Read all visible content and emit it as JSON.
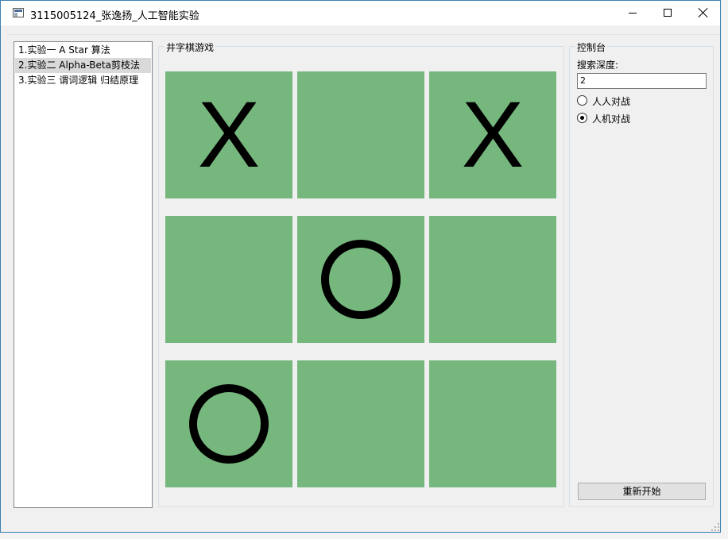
{
  "window": {
    "title": "3115005124_张逸扬_人工智能实验"
  },
  "experiments": [
    {
      "label": "1.实验一  A Star 算法",
      "selected": false
    },
    {
      "label": "2.实验二  Alpha-Beta剪枝法",
      "selected": true
    },
    {
      "label": "3.实验三  谓词逻辑 归结原理",
      "selected": false
    }
  ],
  "game": {
    "title": "井字棋游戏",
    "board": [
      "X",
      "",
      "X",
      "",
      "O",
      "",
      "O",
      "",
      ""
    ]
  },
  "console": {
    "title": "控制台",
    "depth_label": "搜索深度:",
    "depth_value": "2",
    "modes": [
      {
        "label": "人人对战",
        "checked": false
      },
      {
        "label": "人机对战",
        "checked": true
      }
    ],
    "restart_label": "重新开始"
  },
  "colors": {
    "cell_bg": "#76b77e",
    "accent_border": "#3c7fb1"
  }
}
